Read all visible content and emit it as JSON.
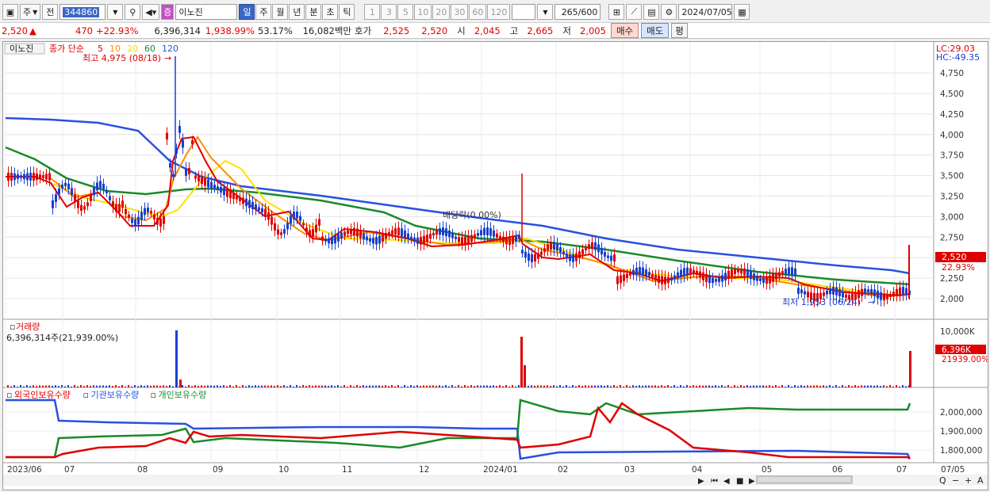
{
  "toolbar": {
    "type_label": "주",
    "prev_label": "전",
    "code_value": "344860",
    "stock_name": "이노진",
    "name_badge": "증",
    "period_tabs": [
      "일",
      "주",
      "월",
      "년",
      "분",
      "초",
      "틱"
    ],
    "period_active": "일",
    "intervals": [
      "1",
      "3",
      "5",
      "10",
      "20",
      "30",
      "60",
      "120"
    ],
    "count_value": "265",
    "count_total": "/600",
    "date_value": "2024/07/05"
  },
  "quote": {
    "price": "2,520",
    "change_arrow": "▲",
    "change": "470",
    "change_pct": "+22.93%",
    "volume": "6,396,314",
    "volume_pct": "1,938.99%",
    "turnover_pct": "53.17%",
    "amount": "16,082백만",
    "hoga_label": "호가",
    "ask": "2,525",
    "bid": "2,520",
    "open_label": "시",
    "open": "2,045",
    "high_label": "고",
    "high": "2,665",
    "low_label": "저",
    "low": "2,005",
    "buy_label": "매수",
    "sell_label": "매도",
    "eval_label": "평"
  },
  "price_pane": {
    "name": "이노진",
    "ma_label": "종가 단순",
    "ma_periods": [
      "5",
      "10",
      "20",
      "60",
      "120"
    ],
    "ma_colors": [
      "#e00000",
      "#ff8c00",
      "#ffe000",
      "#1a8a2a",
      "#2851e0"
    ],
    "high_note": "최고 4,975 (08/18)",
    "low_note": "최저 1,953 (06/24)",
    "dividend_note": "배당락(0.00%)",
    "lc": "LC:29.03",
    "hc": "HC:-49.35",
    "last_price": "2,520",
    "last_pct": "22.93%",
    "y_ticks": [
      "4,750",
      "4,500",
      "4,250",
      "4,000",
      "3,750",
      "3,500",
      "3,250",
      "3,000",
      "2,750",
      "2,500",
      "2,250",
      "2,000"
    ]
  },
  "volume_pane": {
    "title": "거래량",
    "value": "6,396,314주(21,939.00%)",
    "y_tick": "10,000K",
    "last_value": "6,396K",
    "last_pct": "21939.00%"
  },
  "holdings_pane": {
    "labels": [
      "외국인보유수량",
      "기관보유수량",
      "개인보유수량"
    ],
    "colors": [
      "#e00000",
      "#2851e0",
      "#1a8a2a"
    ],
    "y_ticks": [
      "2,000,000",
      "1,900,000",
      "1,800,000"
    ]
  },
  "x_axis": {
    "labels": [
      "2023/06",
      "07",
      "08",
      "09",
      "10",
      "11",
      "12",
      "2024/01",
      "02",
      "03",
      "04",
      "05",
      "06",
      "07"
    ],
    "last_date": "07/05"
  }
}
